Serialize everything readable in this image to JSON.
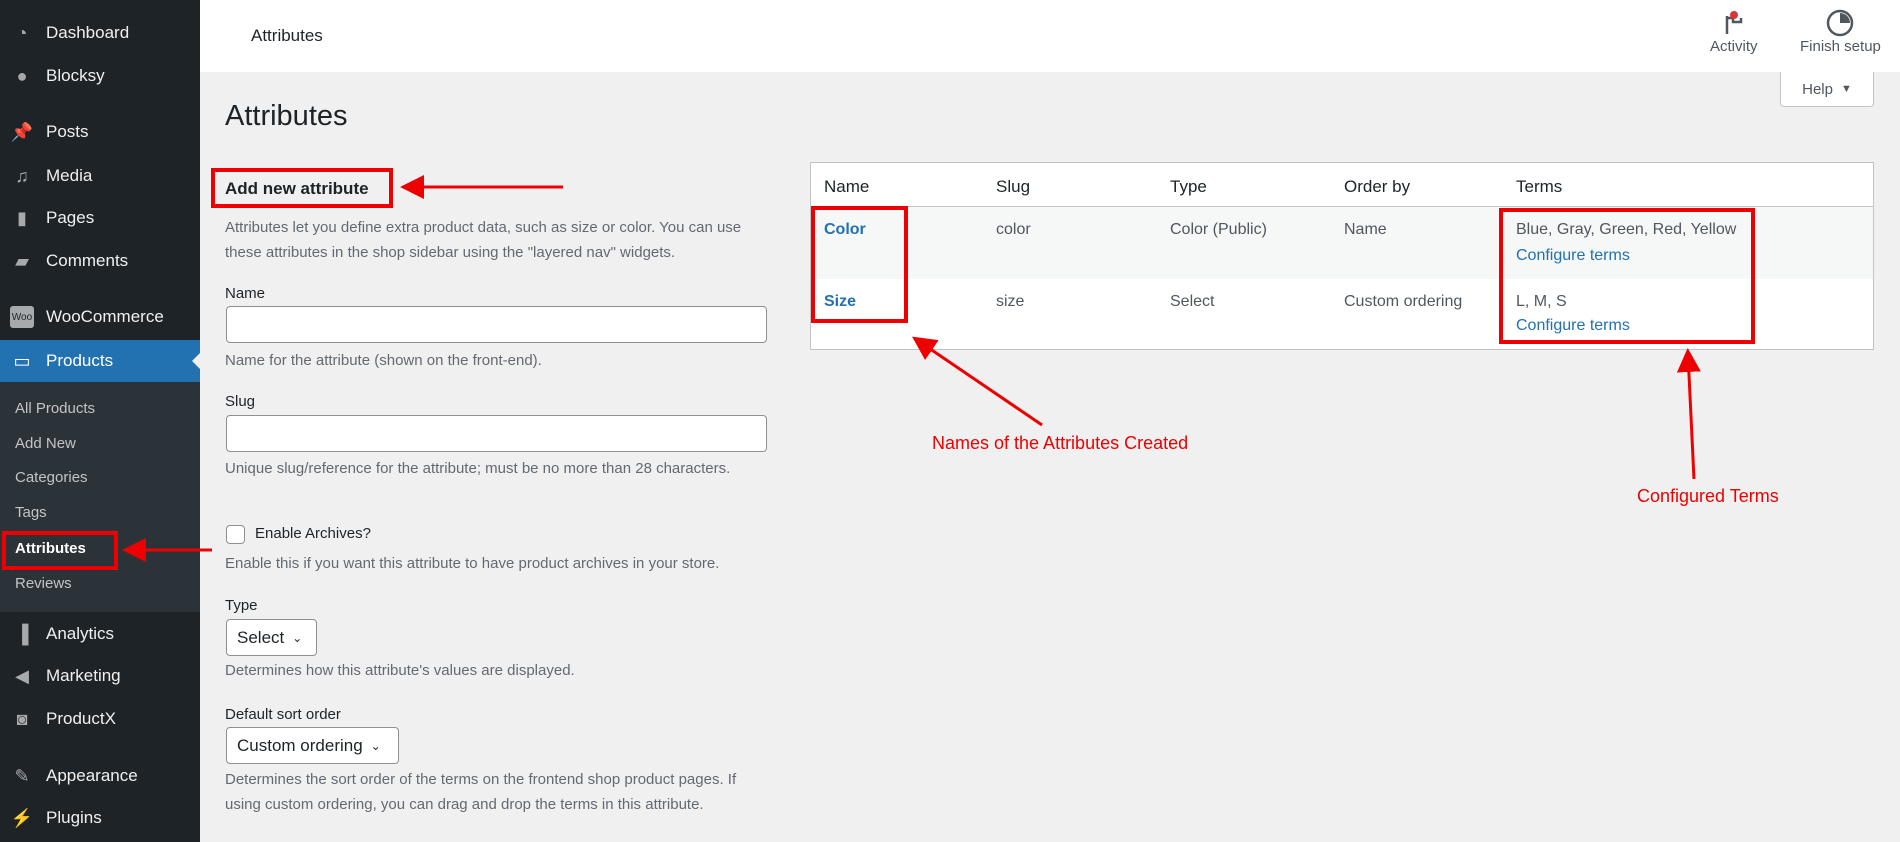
{
  "sidebar": {
    "items": [
      {
        "label": "Dashboard",
        "icon": "dashboard-icon"
      },
      {
        "label": "Blocksy",
        "icon": "blocksy-icon"
      },
      {
        "label": "Posts",
        "icon": "pin-icon"
      },
      {
        "label": "Media",
        "icon": "media-icon"
      },
      {
        "label": "Pages",
        "icon": "pages-icon"
      },
      {
        "label": "Comments",
        "icon": "comment-icon"
      },
      {
        "label": "WooCommerce",
        "icon": "woo-icon"
      },
      {
        "label": "Products",
        "icon": "archive-icon"
      },
      {
        "label": "Analytics",
        "icon": "bar-chart-icon"
      },
      {
        "label": "Marketing",
        "icon": "megaphone-icon"
      },
      {
        "label": "ProductX",
        "icon": "bag-icon"
      },
      {
        "label": "Appearance",
        "icon": "brush-icon"
      },
      {
        "label": "Plugins",
        "icon": "plug-icon"
      }
    ],
    "submenu": [
      "All Products",
      "Add New",
      "Categories",
      "Tags",
      "Attributes",
      "Reviews"
    ]
  },
  "topbar": {
    "title": "Attributes",
    "activity": "Activity",
    "finish_setup": "Finish setup",
    "help": "Help"
  },
  "page_title": "Attributes",
  "form": {
    "heading": "Add new attribute",
    "intro": "Attributes let you define extra product data, such as size or color. You can use these attributes in the shop sidebar using the \"layered nav\" widgets.",
    "name_label": "Name",
    "name_value": "",
    "name_help": "Name for the attribute (shown on the front-end).",
    "slug_label": "Slug",
    "slug_value": "",
    "slug_help": "Unique slug/reference for the attribute; must be no more than 28 characters.",
    "archives_label": "Enable Archives?",
    "archives_checked": false,
    "archives_help": "Enable this if you want this attribute to have product archives in your store.",
    "type_label": "Type",
    "type_value": "Select",
    "type_help": "Determines how this attribute's values are displayed.",
    "sort_label": "Default sort order",
    "sort_value": "Custom ordering",
    "sort_help": "Determines the sort order of the terms on the frontend shop product pages. If using custom ordering, you can drag and drop the terms in this attribute."
  },
  "table": {
    "headers": [
      "Name",
      "Slug",
      "Type",
      "Order by",
      "Terms"
    ],
    "rows": [
      {
        "name": "Color",
        "slug": "color",
        "type": "Color (Public)",
        "order": "Name",
        "terms": "Blue, Gray, Green, Red, Yellow",
        "link": "Configure terms"
      },
      {
        "name": "Size",
        "slug": "size",
        "type": "Select",
        "order": "Custom ordering",
        "terms": "L, M, S",
        "link": "Configure terms"
      }
    ]
  },
  "annotations": {
    "names": "Names of the Attributes Created",
    "terms": "Configured Terms"
  },
  "colors": {
    "annotation": "#ee0000",
    "accent": "#2271b1",
    "sidebar": "#1d2327"
  }
}
